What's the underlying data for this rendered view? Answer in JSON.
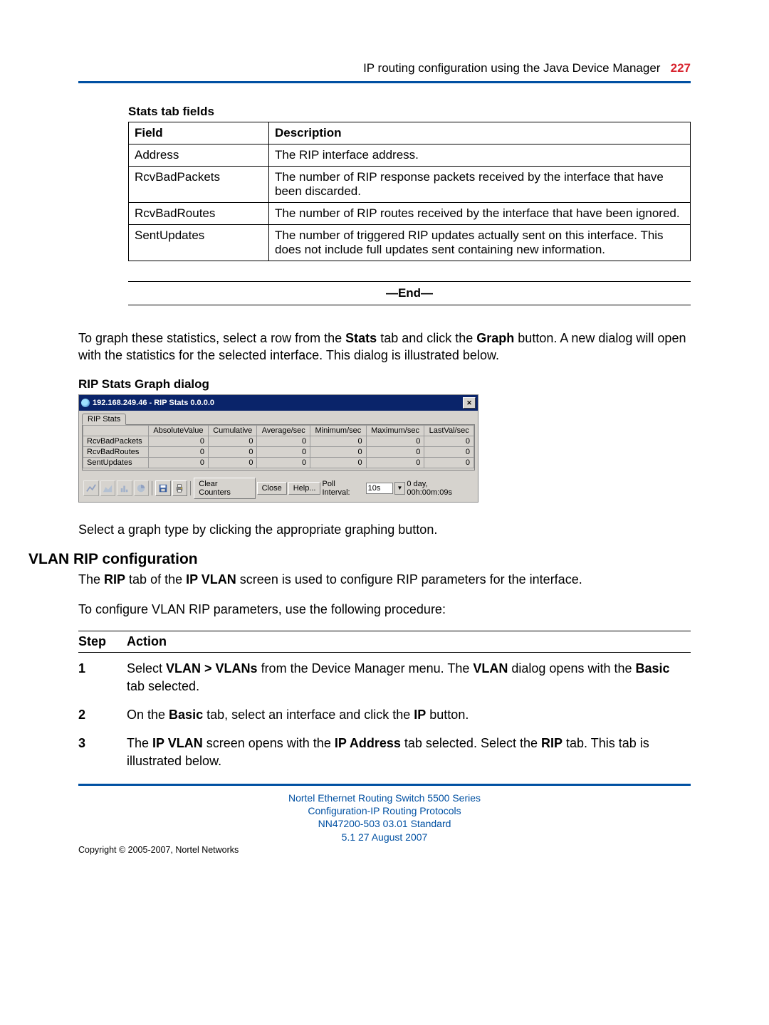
{
  "header": {
    "title": "IP routing configuration using the Java Device Manager",
    "page_number": "227"
  },
  "stats_table": {
    "caption": "Stats tab fields",
    "col_field": "Field",
    "col_desc": "Description",
    "rows": [
      {
        "field": "Address",
        "desc": "The RIP interface address."
      },
      {
        "field": "RcvBadPackets",
        "desc": "The number of RIP response packets received by the interface that have been discarded."
      },
      {
        "field": "RcvBadRoutes",
        "desc": "The number of RIP routes received by the interface that have been ignored."
      },
      {
        "field": "SentUpdates",
        "desc": "The number of triggered RIP updates actually sent on this interface. This does not include full updates sent containing new information."
      }
    ]
  },
  "end_marker": "—End—",
  "para_graph_1a": "To graph these statistics, select a row from the ",
  "para_graph_1b": "Stats",
  "para_graph_1c": " tab and click the ",
  "para_graph_1d": "Graph",
  "para_graph_1e": " button. A new dialog will open with the statistics for the selected interface. This dialog is illustrated below.",
  "dlg_caption": "RIP Stats Graph dialog",
  "dialog": {
    "title": "192.168.249.46 - RIP Stats 0.0.0.0",
    "tab": "RIP Stats",
    "columns": [
      "",
      "AbsoluteValue",
      "Cumulative",
      "Average/sec",
      "Minimum/sec",
      "Maximum/sec",
      "LastVal/sec"
    ],
    "rows": [
      {
        "name": "RcvBadPackets",
        "vals": [
          "0",
          "0",
          "0",
          "0",
          "0",
          "0"
        ]
      },
      {
        "name": "RcvBadRoutes",
        "vals": [
          "0",
          "0",
          "0",
          "0",
          "0",
          "0"
        ]
      },
      {
        "name": "SentUpdates",
        "vals": [
          "0",
          "0",
          "0",
          "0",
          "0",
          "0"
        ]
      }
    ],
    "buttons": {
      "clear_counters": "Clear Counters",
      "close": "Close",
      "help": "Help...",
      "poll_label": "Poll Interval:",
      "poll_value": "10s",
      "runtime": "0 day, 00h:00m:09s"
    }
  },
  "para_select_graph": "Select a graph type by clicking the appropriate graphing button.",
  "section_heading": "VLAN RIP configuration",
  "vlan_para_1a": "The ",
  "vlan_para_1b": "RIP",
  "vlan_para_1c": " tab of the ",
  "vlan_para_1d": "IP VLAN",
  "vlan_para_1e": " screen is used to configure RIP parameters for the interface.",
  "vlan_para_2": "To configure VLAN RIP parameters, use the following procedure:",
  "step_hdr": {
    "step": "Step",
    "action": "Action"
  },
  "steps": [
    {
      "n": "1",
      "t1": "Select ",
      "b1": "VLAN > VLANs",
      "t2": " from the Device Manager menu. The ",
      "b2": "VLAN",
      "t3": " dialog opens with the ",
      "b3": "Basic",
      "t4": " tab selected."
    },
    {
      "n": "2",
      "t1": "On the ",
      "b1": "Basic",
      "t2": " tab, select an interface and click the ",
      "b2": "IP",
      "t3": " button.",
      "b3": "",
      "t4": ""
    },
    {
      "n": "3",
      "t1": "The ",
      "b1": "IP VLAN",
      "t2": " screen opens with the ",
      "b2": "IP Address",
      "t3": " tab selected. Select the ",
      "b3": "RIP",
      "t4": " tab. This tab is illustrated below."
    }
  ],
  "footer": {
    "l1": "Nortel Ethernet Routing Switch 5500 Series",
    "l2": "Configuration-IP Routing Protocols",
    "l3": "NN47200-503   03.01   Standard",
    "l4": "5.1   27 August 2007",
    "copyright": "Copyright © 2005-2007, Nortel Networks"
  }
}
